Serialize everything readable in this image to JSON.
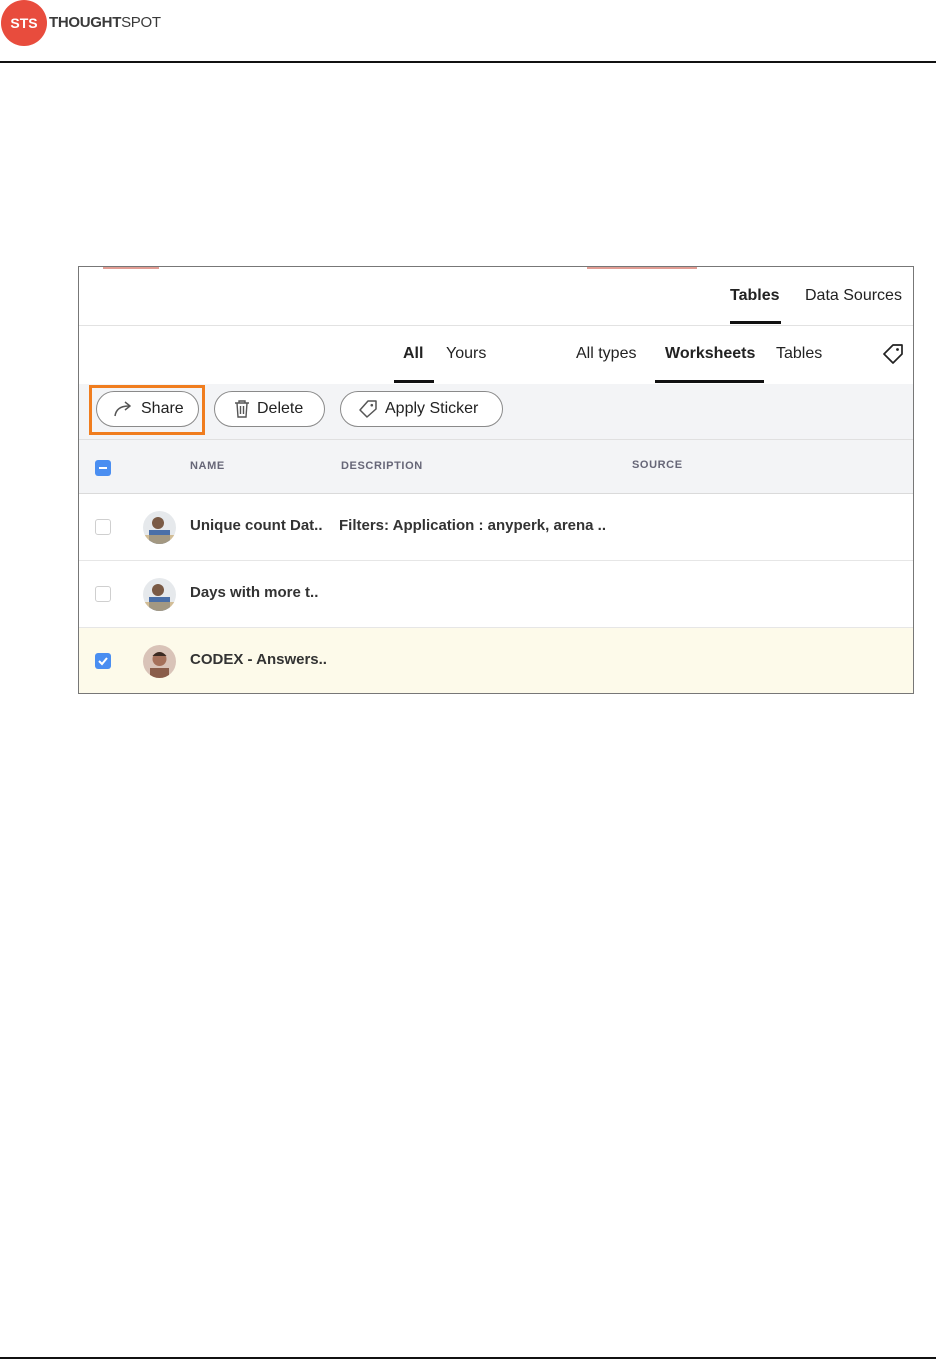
{
  "brand": {
    "logo_mark": "STS",
    "name_bold": "THOUGHT",
    "name_light": "SPOT"
  },
  "top_tabs": [
    {
      "label": "Tables",
      "active": true
    },
    {
      "label": "Data Sources",
      "active": false
    }
  ],
  "owner_filters": [
    {
      "label": "All",
      "active": true
    },
    {
      "label": "Yours",
      "active": false
    }
  ],
  "type_filters": [
    {
      "label": "All types",
      "active": false
    },
    {
      "label": "Worksheets",
      "active": true
    },
    {
      "label": "Tables",
      "active": false
    }
  ],
  "toolbar": {
    "share": "Share",
    "delete": "Delete",
    "apply_sticker": "Apply Sticker"
  },
  "columns": [
    "NAME",
    "DESCRIPTION",
    "SOURCE"
  ],
  "rows": [
    {
      "name": "Unique count Dat..",
      "description": "Filters: Application : anyperk, arena ..",
      "source": "",
      "checked": false
    },
    {
      "name": "Days with more t..",
      "description": "",
      "source": "",
      "checked": false
    },
    {
      "name": "CODEX - Answers..",
      "description": "",
      "source": "",
      "checked": true
    }
  ],
  "colors": {
    "accent": "#f07d1e",
    "brand": "#e84c3d",
    "checkbox": "#4a8ef1",
    "selected_row": "#fdfaea"
  }
}
